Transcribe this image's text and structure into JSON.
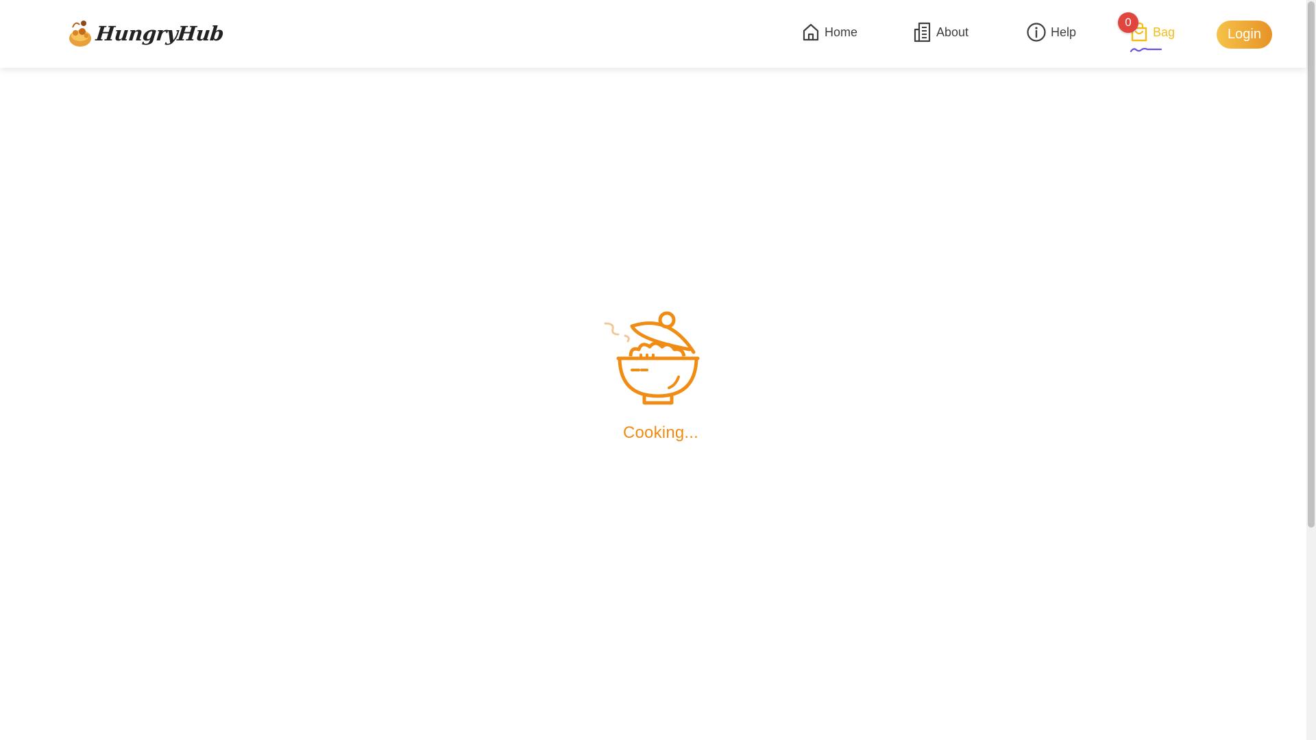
{
  "header": {
    "brand": {
      "name": "HungryHub",
      "icon": "food-bowl-logo-icon"
    },
    "nav": [
      {
        "id": "home",
        "label": "Home",
        "icon": "home-icon"
      },
      {
        "id": "about",
        "label": "About",
        "icon": "building-icon"
      },
      {
        "id": "help",
        "label": "Help",
        "icon": "info-icon"
      },
      {
        "id": "bag",
        "label": "Bag",
        "icon": "shopping-bag-icon",
        "badge": "0",
        "active": true
      }
    ],
    "login_label": "Login"
  },
  "main": {
    "loader_icon": "cooking-pot-icon",
    "loading_text": "Cooking..."
  },
  "colors": {
    "accent_orange": "#f08c13",
    "bag_yellow": "#f4bd16",
    "badge_red": "#e0453e",
    "login_gradient_start": "#f6c34a",
    "login_gradient_end": "#e79224",
    "active_underline": "#6a4fe0",
    "nav_text": "#3d3d3d"
  }
}
